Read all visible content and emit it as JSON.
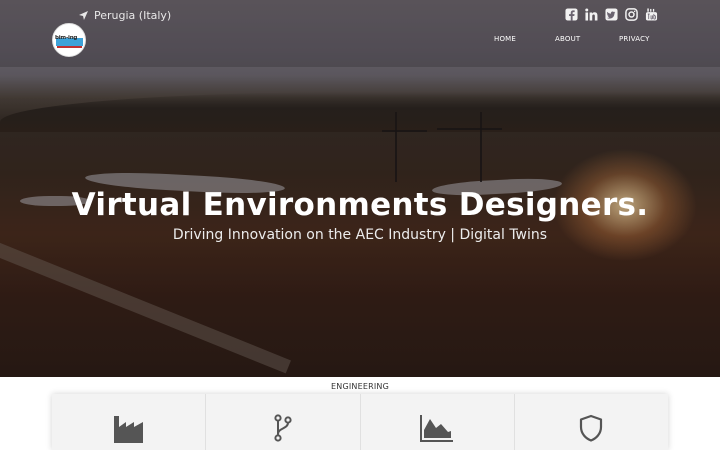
{
  "header": {
    "location": "Perugia (Italy)",
    "logo_text": "bim-ing",
    "social": [
      {
        "name": "facebook",
        "icon": "facebook-icon"
      },
      {
        "name": "linkedin",
        "icon": "linkedin-icon"
      },
      {
        "name": "twitter",
        "icon": "twitter-icon"
      },
      {
        "name": "instagram",
        "icon": "instagram-icon"
      },
      {
        "name": "youtube",
        "icon": "youtube-icon"
      }
    ],
    "nav": [
      "HOME",
      "ABOUT",
      "PRIVACY"
    ]
  },
  "hero": {
    "title": "Virtual Environments Designers.",
    "subtitle": "Driving Innovation on the AEC Industry | Digital Twins"
  },
  "section": {
    "title": "ENGINEERING",
    "cards": [
      {
        "icon": "factory-icon"
      },
      {
        "icon": "branch-icon"
      },
      {
        "icon": "area-chart-icon"
      },
      {
        "icon": "shield-icon"
      }
    ]
  },
  "colors": {
    "nav_text": "#ffffff",
    "icon": "#555555",
    "card_bg": "#f3f3f3"
  }
}
